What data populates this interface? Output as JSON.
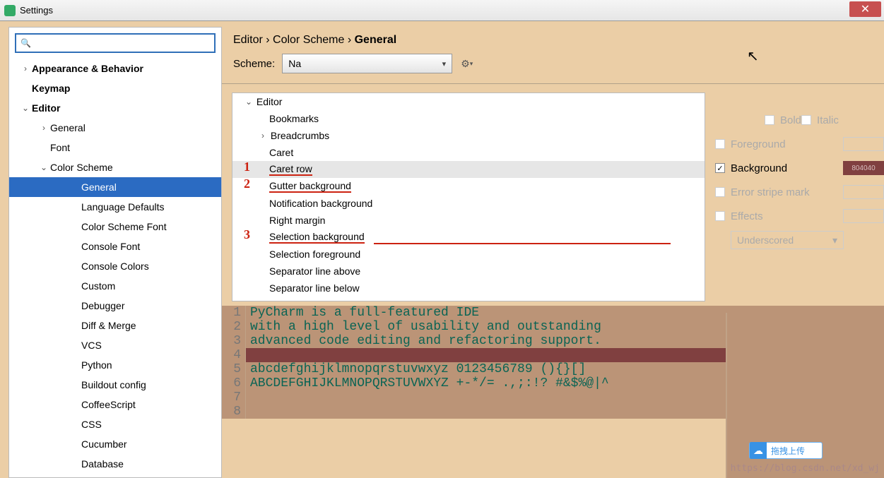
{
  "window": {
    "title": "Settings"
  },
  "search": {
    "placeholder": ""
  },
  "sidebar": {
    "items": [
      {
        "label": "Appearance & Behavior",
        "indent": "ind1",
        "arrow": "›",
        "bold": true
      },
      {
        "label": "Keymap",
        "indent": "ind1",
        "arrow": "",
        "bold": true
      },
      {
        "label": "Editor",
        "indent": "ind1",
        "arrow": "⌄",
        "bold": true
      },
      {
        "label": "General",
        "indent": "ind2",
        "arrow": "›",
        "bold": false
      },
      {
        "label": "Font",
        "indent": "ind2",
        "arrow": "",
        "bold": false
      },
      {
        "label": "Color Scheme",
        "indent": "ind2",
        "arrow": "⌄",
        "bold": false
      },
      {
        "label": "General",
        "indent": "ind4",
        "arrow": "",
        "bold": false,
        "selected": true
      },
      {
        "label": "Language Defaults",
        "indent": "ind4",
        "arrow": "",
        "bold": false
      },
      {
        "label": "Color Scheme Font",
        "indent": "ind4",
        "arrow": "",
        "bold": false
      },
      {
        "label": "Console Font",
        "indent": "ind4",
        "arrow": "",
        "bold": false
      },
      {
        "label": "Console Colors",
        "indent": "ind4",
        "arrow": "",
        "bold": false
      },
      {
        "label": "Custom",
        "indent": "ind4",
        "arrow": "",
        "bold": false
      },
      {
        "label": "Debugger",
        "indent": "ind4",
        "arrow": "",
        "bold": false
      },
      {
        "label": "Diff & Merge",
        "indent": "ind4",
        "arrow": "",
        "bold": false
      },
      {
        "label": "VCS",
        "indent": "ind4",
        "arrow": "",
        "bold": false
      },
      {
        "label": "Python",
        "indent": "ind4",
        "arrow": "",
        "bold": false
      },
      {
        "label": "Buildout config",
        "indent": "ind4",
        "arrow": "",
        "bold": false
      },
      {
        "label": "CoffeeScript",
        "indent": "ind4",
        "arrow": "",
        "bold": false
      },
      {
        "label": "CSS",
        "indent": "ind4",
        "arrow": "",
        "bold": false
      },
      {
        "label": "Cucumber",
        "indent": "ind4",
        "arrow": "",
        "bold": false
      },
      {
        "label": "Database",
        "indent": "ind4",
        "arrow": "",
        "bold": false
      }
    ]
  },
  "breadcrumbs": {
    "a": "Editor",
    "b": "Color Scheme",
    "c": "General",
    "sep": " › "
  },
  "scheme": {
    "label": "Scheme:",
    "value": "Na"
  },
  "options": {
    "root": "Editor",
    "items": [
      {
        "label": "Bookmarks"
      },
      {
        "label": "Breadcrumbs",
        "arrow": "›"
      },
      {
        "label": "Caret"
      },
      {
        "label": "Caret row",
        "selected": true,
        "underline": true,
        "num": "1"
      },
      {
        "label": "Gutter background",
        "underline": true,
        "num": "2"
      },
      {
        "label": "Notification background"
      },
      {
        "label": "Right margin"
      },
      {
        "label": "Selection background",
        "underline": true,
        "num": "3",
        "longline": true
      },
      {
        "label": "Selection foreground"
      },
      {
        "label": "Separator line above"
      },
      {
        "label": "Separator line below"
      }
    ]
  },
  "props": {
    "bold": "Bold",
    "italic": "Italic",
    "foreground": "Foreground",
    "background": "Background",
    "errorstripe": "Error stripe mark",
    "effects": "Effects",
    "effects_value": "Underscored",
    "bg_value": "804040"
  },
  "preview": {
    "lines": [
      {
        "n": "1",
        "t": "PyCharm is a full-featured IDE"
      },
      {
        "n": "2",
        "t": "with a high level of usability and outstanding"
      },
      {
        "n": "3",
        "t": "advanced code editing and refactoring support."
      },
      {
        "n": "4",
        "t": "",
        "caret": true
      },
      {
        "n": "5",
        "t": "abcdefghijklmnopqrstuvwxyz 0123456789 (){}[]"
      },
      {
        "n": "6",
        "t": "ABCDEFGHIJKLMNOPQRSTUVWXYZ +-*/= .,;:!? #&$%@|^"
      },
      {
        "n": "7",
        "t": ""
      },
      {
        "n": "8",
        "t": ""
      }
    ]
  },
  "float": {
    "label": "拖拽上传"
  },
  "watermark": "https://blog.csdn.net/xd_wj"
}
